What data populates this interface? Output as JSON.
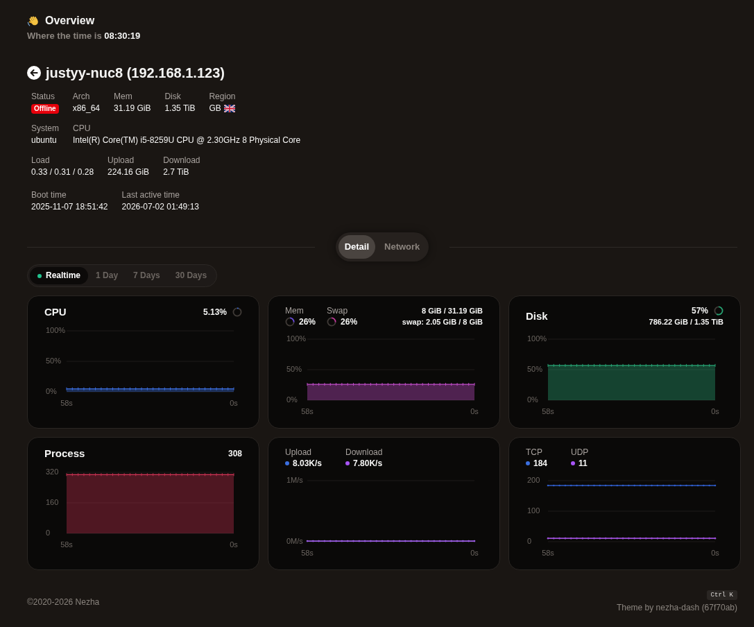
{
  "header": {
    "title": "Overview",
    "time_label": "Where the time is",
    "time": "08:30:19"
  },
  "server": {
    "name": "justyy-nuc8 (192.168.1.123)",
    "info_rows": [
      [
        {
          "label": "Status",
          "kind": "status",
          "value": "Offline",
          "online": false
        },
        {
          "label": "Arch",
          "kind": "text",
          "value": "x86_64"
        },
        {
          "label": "Mem",
          "kind": "text",
          "value": "31.19 GiB"
        },
        {
          "label": "Disk",
          "kind": "text",
          "value": "1.35 TiB"
        },
        {
          "label": "Region",
          "kind": "region",
          "value": "GB"
        }
      ],
      [
        {
          "label": "System",
          "kind": "text",
          "value": "ubuntu"
        },
        {
          "label": "CPU",
          "kind": "text",
          "value": "Intel(R) Core(TM) i5-8259U CPU @ 2.30GHz 8 Physical Core"
        }
      ],
      [
        {
          "label": "Load",
          "kind": "text",
          "value": "0.33 / 0.31 / 0.28"
        },
        {
          "label": "Upload",
          "kind": "text",
          "value": "224.16 GiB"
        },
        {
          "label": "Download",
          "kind": "text",
          "value": "2.7 TiB"
        }
      ],
      [
        {
          "label": "Boot time",
          "kind": "text",
          "value": "2025-11-07 18:51:42"
        },
        {
          "label": "Last active time",
          "kind": "text",
          "value": "2026-07-02 01:49:13"
        }
      ]
    ]
  },
  "view_tabs": [
    {
      "label": "Detail",
      "selected": true
    },
    {
      "label": "Network",
      "selected": false
    }
  ],
  "period_tabs": [
    {
      "label": "Realtime",
      "selected": true,
      "live": true
    },
    {
      "label": "1 Day",
      "selected": false,
      "live": false
    },
    {
      "label": "7 Days",
      "selected": false,
      "live": false
    },
    {
      "label": "30 Days",
      "selected": false,
      "live": false
    }
  ],
  "cards": [
    {
      "kind": "gauge",
      "title": "CPU",
      "value": "5.13%",
      "level": 0.0513,
      "chart_data": {
        "type": "area",
        "categories": [
          "58s",
          null,
          null,
          null,
          null,
          null,
          null,
          null,
          null,
          null,
          null,
          null,
          null,
          null,
          null,
          null,
          null,
          null,
          null,
          null,
          null,
          null,
          null,
          null,
          null,
          null,
          null,
          null,
          null,
          "0s"
        ],
        "ylim": [
          0,
          100
        ],
        "yticks": [
          {
            "value": 0,
            "label": "0%"
          },
          {
            "value": 50,
            "label": "50%"
          },
          {
            "value": 100,
            "label": "100%"
          }
        ],
        "series": [
          {
            "color": "#3b6fe0",
            "values": [
              5,
              5,
              5,
              5,
              5,
              5,
              5,
              5,
              5,
              5,
              5,
              5,
              5,
              5,
              5,
              5,
              5,
              5,
              5,
              5,
              5,
              5,
              5,
              5,
              5,
              5,
              5,
              5,
              5,
              5
            ]
          }
        ]
      }
    },
    {
      "kind": "memory",
      "metrics": [
        {
          "label": "Mem",
          "value": "26%",
          "level": 0.26,
          "color": "#6d4ee0"
        },
        {
          "label": "Swap",
          "value": "26%",
          "level": 0.26,
          "color": "#c2399b"
        }
      ],
      "details": [
        "8 GiB / 31.19 GiB",
        "swap: 2.05 GiB / 8 GiB"
      ],
      "chart_data": {
        "type": "area",
        "categories": [
          "58s",
          null,
          null,
          null,
          null,
          null,
          null,
          null,
          null,
          null,
          null,
          null,
          null,
          null,
          null,
          null,
          null,
          null,
          null,
          null,
          null,
          null,
          null,
          null,
          null,
          null,
          null,
          null,
          null,
          "0s"
        ],
        "ylim": [
          0,
          100
        ],
        "yticks": [
          {
            "value": 0,
            "label": "0%"
          },
          {
            "value": 50,
            "label": "50%"
          },
          {
            "value": 100,
            "label": "100%"
          }
        ],
        "series": [
          {
            "color": "#c04cc8",
            "values": [
              26,
              26,
              26,
              26,
              26,
              26,
              26,
              26,
              26,
              26,
              26,
              26,
              26,
              26,
              26,
              26,
              26,
              26,
              26,
              26,
              26,
              26,
              26,
              26,
              26,
              26,
              26,
              26,
              26,
              26
            ]
          }
        ]
      }
    },
    {
      "kind": "gauge",
      "title": "Disk",
      "value": "57%",
      "level": 0.57,
      "details": [
        "786.22 GiB / 1.35 TiB"
      ],
      "chart_data": {
        "type": "area",
        "categories": [
          "58s",
          null,
          null,
          null,
          null,
          null,
          null,
          null,
          null,
          null,
          null,
          null,
          null,
          null,
          null,
          null,
          null,
          null,
          null,
          null,
          null,
          null,
          null,
          null,
          null,
          null,
          null,
          null,
          null,
          "0s"
        ],
        "ylim": [
          0,
          100
        ],
        "yticks": [
          {
            "value": 0,
            "label": "0%"
          },
          {
            "value": 50,
            "label": "50%"
          },
          {
            "value": 100,
            "label": "100%"
          }
        ],
        "series": [
          {
            "color": "#27a373",
            "values": [
              57,
              57,
              57,
              57,
              57,
              57,
              57,
              57,
              57,
              57,
              57,
              57,
              57,
              57,
              57,
              57,
              57,
              57,
              57,
              57,
              57,
              57,
              57,
              57,
              57,
              57,
              57,
              57,
              57,
              57
            ]
          }
        ]
      }
    },
    {
      "kind": "counter",
      "title": "Process",
      "value": "308",
      "chart_data": {
        "type": "area",
        "categories": [
          "58s",
          null,
          null,
          null,
          null,
          null,
          null,
          null,
          null,
          null,
          null,
          null,
          null,
          null,
          null,
          null,
          null,
          null,
          null,
          null,
          null,
          null,
          null,
          null,
          null,
          null,
          null,
          null,
          null,
          "0s"
        ],
        "ylim": [
          0,
          320
        ],
        "yticks": [
          0,
          160,
          320
        ],
        "series": [
          {
            "color": "#c0304f",
            "values": [
              308,
              308,
              308,
              308,
              308,
              308,
              308,
              308,
              308,
              308,
              308,
              308,
              308,
              308,
              308,
              308,
              308,
              308,
              308,
              308,
              308,
              308,
              308,
              308,
              308,
              308,
              308,
              308,
              308,
              308
            ]
          }
        ]
      }
    },
    {
      "kind": "legend",
      "items": [
        {
          "label": "Upload",
          "value": "8.03K/s",
          "color": "#3b6fe0"
        },
        {
          "label": "Download",
          "value": "7.80K/s",
          "color": "#a855f7"
        }
      ],
      "chart_data": {
        "type": "line",
        "categories": [
          "58s",
          null,
          null,
          null,
          null,
          null,
          null,
          null,
          null,
          null,
          null,
          null,
          null,
          null,
          null,
          null,
          null,
          null,
          null,
          null,
          null,
          null,
          null,
          null,
          null,
          null,
          null,
          null,
          null,
          "0s"
        ],
        "ylim": [
          0,
          1
        ],
        "yticks": [
          {
            "value": 0,
            "label": "0M/s"
          },
          {
            "value": 1,
            "label": "1M/s"
          }
        ],
        "series": [
          {
            "color": "#9b5de5",
            "values": [
              0.01,
              0.01,
              0.01,
              0.01,
              0.01,
              0.01,
              0.01,
              0.01,
              0.01,
              0.01,
              0.01,
              0.01,
              0.01,
              0.01,
              0.01,
              0.01,
              0.01,
              0.01,
              0.01,
              0.01,
              0.01,
              0.01,
              0.01,
              0.01,
              0.01,
              0.01,
              0.01,
              0.01,
              0.01,
              0.01
            ]
          }
        ]
      }
    },
    {
      "kind": "legend",
      "items": [
        {
          "label": "TCP",
          "value": "184",
          "color": "#3b6fe0"
        },
        {
          "label": "UDP",
          "value": "11",
          "color": "#a855f7"
        }
      ],
      "chart_data": {
        "type": "line",
        "categories": [
          "58s",
          null,
          null,
          null,
          null,
          null,
          null,
          null,
          null,
          null,
          null,
          null,
          null,
          null,
          null,
          null,
          null,
          null,
          null,
          null,
          null,
          null,
          null,
          null,
          null,
          null,
          null,
          null,
          null,
          "0s"
        ],
        "ylim": [
          0,
          200
        ],
        "yticks": [
          0,
          100,
          200
        ],
        "series": [
          {
            "color": "#2f5cc8",
            "values": [
              184,
              184,
              184,
              184,
              184,
              184,
              184,
              184,
              184,
              184,
              184,
              184,
              184,
              184,
              184,
              184,
              184,
              184,
              184,
              184,
              184,
              184,
              184,
              184,
              184,
              184,
              184,
              184,
              184,
              184
            ]
          },
          {
            "color": "#9b4fd6",
            "values": [
              11,
              11,
              11,
              11,
              11,
              11,
              11,
              11,
              11,
              11,
              11,
              11,
              11,
              11,
              11,
              11,
              11,
              11,
              11,
              11,
              11,
              11,
              11,
              11,
              11,
              11,
              11,
              11,
              11,
              11
            ]
          }
        ]
      }
    }
  ],
  "footer": {
    "copyright": "©2020-2026 Nezha",
    "shortcut": "Ctrl K",
    "theme": "Theme by nezha-dash (67f70ab)"
  }
}
